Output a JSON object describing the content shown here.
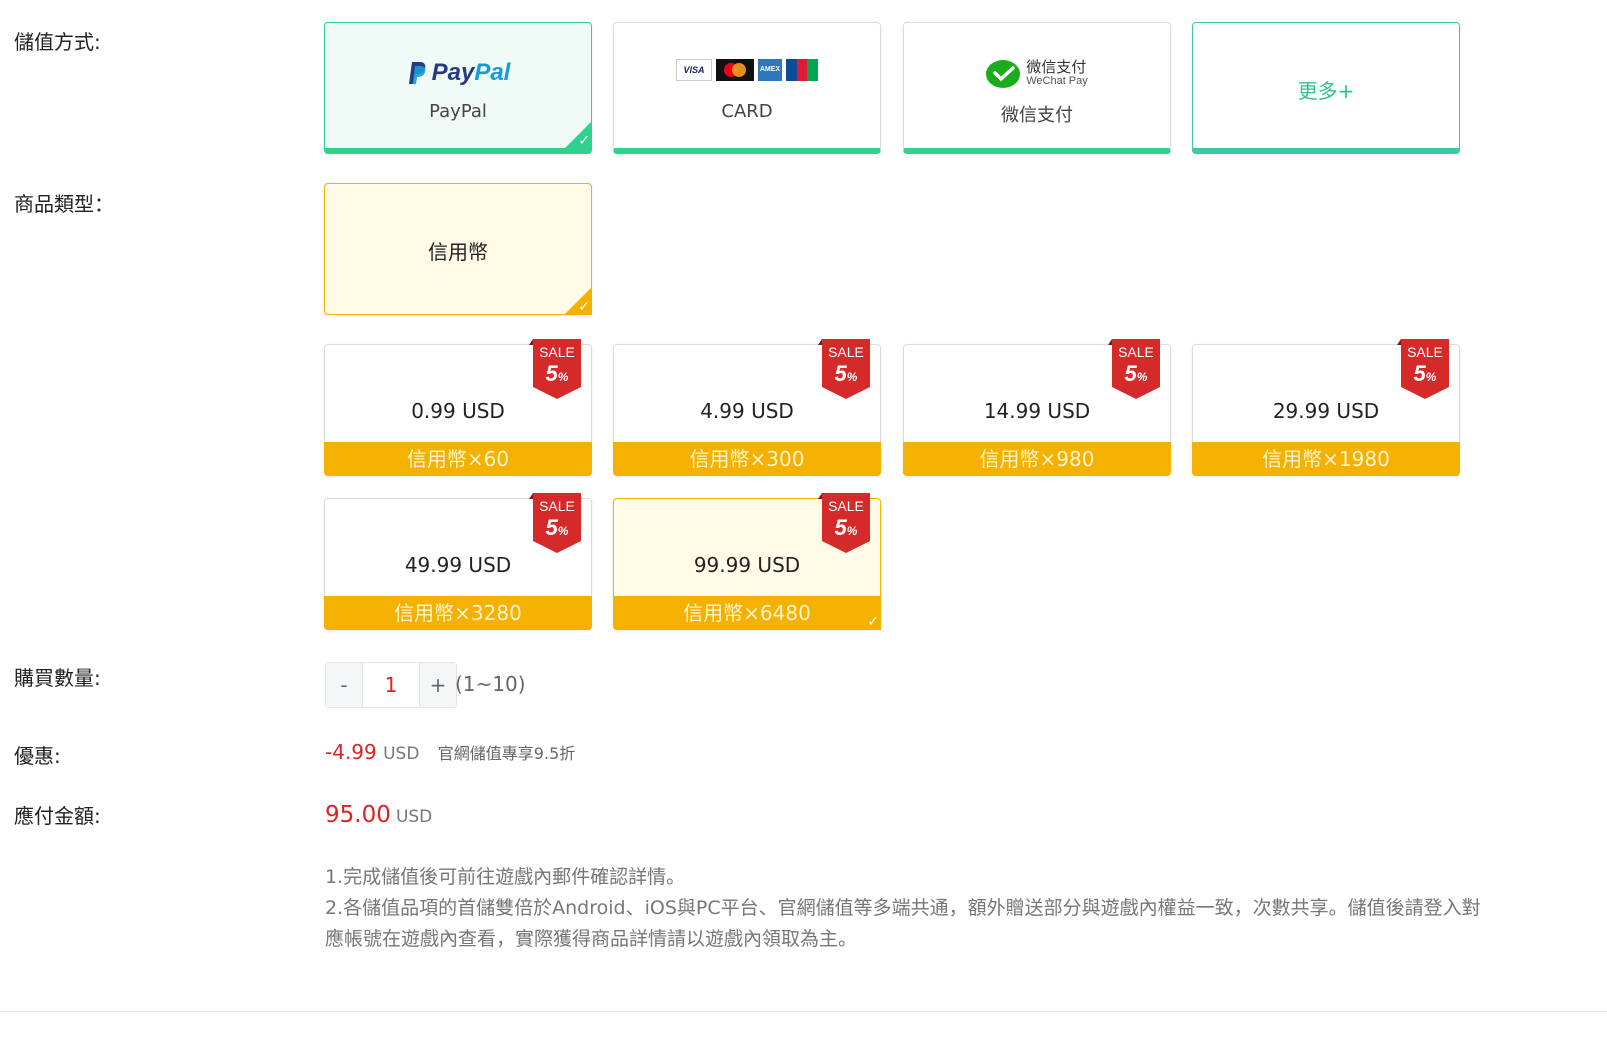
{
  "labels": {
    "payment_method": "儲值方式:",
    "product_type": "商品類型：",
    "quantity": "購買數量:",
    "discount": "優惠:",
    "amount_due": "應付金額:"
  },
  "payment_methods": [
    {
      "name": "PayPal",
      "logo_text": "PayPal",
      "selected": true
    },
    {
      "name": "CARD",
      "logo_cards": [
        "VISA",
        "MC",
        "AMEX",
        "JCB"
      ]
    },
    {
      "name": "微信支付",
      "logo_title": "微信支付",
      "logo_sub": "WeChat Pay"
    },
    {
      "name": "更多+"
    }
  ],
  "product_type": {
    "label": "信用幣",
    "selected": true
  },
  "sale_badge": {
    "top": "SALE",
    "value": "5",
    "unit": "%"
  },
  "products": [
    {
      "price": "0.99 USD",
      "band": "信用幣×60"
    },
    {
      "price": "4.99 USD",
      "band": "信用幣×300"
    },
    {
      "price": "14.99 USD",
      "band": "信用幣×980"
    },
    {
      "price": "29.99 USD",
      "band": "信用幣×1980"
    },
    {
      "price": "49.99 USD",
      "band": "信用幣×3280"
    },
    {
      "price": "99.99 USD",
      "band": "信用幣×6480",
      "selected": true
    }
  ],
  "quantity": {
    "minus": "-",
    "value": "1",
    "plus": "+",
    "range": "(1~10)"
  },
  "discount": {
    "amount": "-4.99",
    "unit": "USD",
    "note": "官網儲值專享9.5折"
  },
  "total": {
    "amount": "95.00",
    "unit": "USD"
  },
  "notes": [
    "1.完成儲值後可前往遊戲內郵件確認詳情。",
    "2.各儲值品項的首儲雙倍於Android、iOS與PC平台、官網儲值等多端共通，額外贈送部分與遊戲內權益一致，次數共享。儲值後請登入對應帳號在遊戲內查看，實際獲得商品詳情請以遊戲內領取為主。"
  ],
  "colors": {
    "accent_green": "#2fd18f",
    "accent_yellow": "#f5b100",
    "sale_red": "#d42a2a",
    "price_red": "#dd2222"
  }
}
